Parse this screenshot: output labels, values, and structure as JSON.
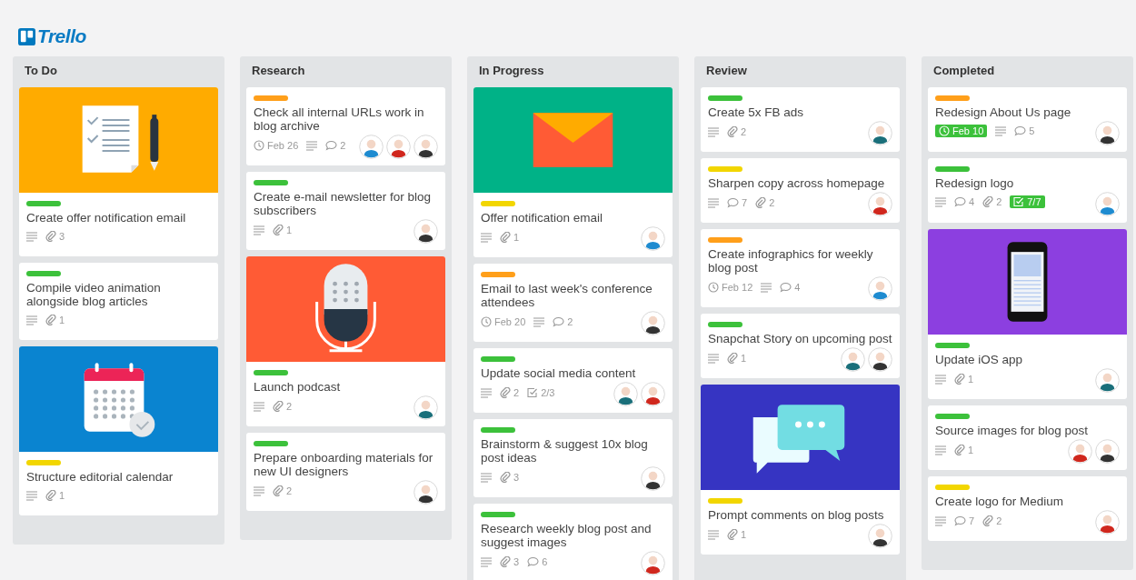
{
  "logo": {
    "text": "Trello"
  },
  "lists": [
    {
      "title": "To Do",
      "cards": [
        {
          "cover": {
            "kind": "document",
            "color": "#ffab00"
          },
          "label": {
            "color": "#3cc13b"
          },
          "title": "Create offer notification email",
          "badges": [
            {
              "kind": "description"
            },
            {
              "kind": "attachments",
              "text": "3"
            }
          ]
        },
        {
          "label": {
            "color": "#3cc13b"
          },
          "title": "Compile video animation alongside blog articles",
          "badges": [
            {
              "kind": "description"
            },
            {
              "kind": "attachments",
              "text": "1"
            }
          ]
        },
        {
          "cover": {
            "kind": "calendar",
            "color": "#0a84d0"
          },
          "label": {
            "color": "#f2d600"
          },
          "title": "Structure editorial calendar",
          "badges": [
            {
              "kind": "description"
            },
            {
              "kind": "attachments",
              "text": "1"
            }
          ]
        }
      ]
    },
    {
      "title": "Research",
      "cards": [
        {
          "label": {
            "color": "#ff9f1a"
          },
          "title": "Check all internal URLs work in blog archive",
          "badges": [
            {
              "kind": "due",
              "text": "Feb 26",
              "complete": false
            },
            {
              "kind": "description"
            },
            {
              "kind": "comments",
              "text": "2"
            }
          ],
          "members": [
            {
              "color": "#1e8bd0"
            },
            {
              "color": "#d0271d"
            },
            {
              "color": "#333333"
            }
          ]
        },
        {
          "label": {
            "color": "#3cc13b"
          },
          "title": "Create e-mail newsletter for blog subscribers",
          "badges": [
            {
              "kind": "description"
            },
            {
              "kind": "attachments",
              "text": "1"
            }
          ],
          "members": [
            {
              "color": "#333333"
            }
          ]
        },
        {
          "cover": {
            "kind": "microphone",
            "color": "#ff5b35"
          },
          "label": {
            "color": "#3cc13b"
          },
          "title": "Launch podcast",
          "badges": [
            {
              "kind": "description"
            },
            {
              "kind": "attachments",
              "text": "2"
            }
          ],
          "members": [
            {
              "color": "#1a6f7a"
            }
          ]
        },
        {
          "label": {
            "color": "#3cc13b"
          },
          "title": "Prepare onboarding materials for new UI designers",
          "badges": [
            {
              "kind": "description"
            },
            {
              "kind": "attachments",
              "text": "2"
            }
          ],
          "members": [
            {
              "color": "#333333"
            }
          ]
        }
      ]
    },
    {
      "title": "In Progress",
      "cards": [
        {
          "cover": {
            "kind": "envelope",
            "color": "#00b287"
          },
          "label": {
            "color": "#f2d600"
          },
          "title": "Offer notification email",
          "badges": [
            {
              "kind": "description"
            },
            {
              "kind": "attachments",
              "text": "1"
            }
          ],
          "members": [
            {
              "color": "#1e8bd0"
            }
          ]
        },
        {
          "label": {
            "color": "#ff9f1a"
          },
          "title": "Email to last week's conference attendees",
          "badges": [
            {
              "kind": "due",
              "text": "Feb 20",
              "complete": false
            },
            {
              "kind": "description"
            },
            {
              "kind": "comments",
              "text": "2"
            }
          ],
          "members": [
            {
              "color": "#333333"
            }
          ]
        },
        {
          "label": {
            "color": "#3cc13b"
          },
          "title": "Update social media content",
          "badges": [
            {
              "kind": "description"
            },
            {
              "kind": "attachments",
              "text": "2"
            },
            {
              "kind": "checklist",
              "text": "2/3",
              "complete": false
            }
          ],
          "members": [
            {
              "color": "#1a6f7a"
            },
            {
              "color": "#d0271d"
            }
          ]
        },
        {
          "label": {
            "color": "#3cc13b"
          },
          "title": "Brainstorm & suggest 10x blog post ideas",
          "badges": [
            {
              "kind": "description"
            },
            {
              "kind": "attachments",
              "text": "3"
            }
          ],
          "members": [
            {
              "color": "#333333"
            }
          ]
        },
        {
          "label": {
            "color": "#3cc13b"
          },
          "title": "Research weekly blog post and suggest images",
          "badges": [
            {
              "kind": "description"
            },
            {
              "kind": "attachments",
              "text": "3"
            },
            {
              "kind": "comments",
              "text": "6"
            }
          ],
          "members": [
            {
              "color": "#d0271d"
            }
          ]
        }
      ]
    },
    {
      "title": "Review",
      "cards": [
        {
          "label": {
            "color": "#3cc13b"
          },
          "title": "Create 5x FB ads",
          "badges": [
            {
              "kind": "description"
            },
            {
              "kind": "attachments",
              "text": "2"
            }
          ],
          "members": [
            {
              "color": "#1a6f7a"
            }
          ]
        },
        {
          "label": {
            "color": "#f2d600"
          },
          "title": "Sharpen copy across homepage",
          "badges": [
            {
              "kind": "description"
            },
            {
              "kind": "comments",
              "text": "7"
            },
            {
              "kind": "attachments",
              "text": "2"
            }
          ],
          "members": [
            {
              "color": "#d0271d"
            }
          ]
        },
        {
          "label": {
            "color": "#ff9f1a"
          },
          "title": "Create infographics for weekly blog post",
          "badges": [
            {
              "kind": "due",
              "text": "Feb 12",
              "complete": false
            },
            {
              "kind": "description"
            },
            {
              "kind": "comments",
              "text": "4"
            }
          ],
          "members": [
            {
              "color": "#1e8bd0"
            }
          ]
        },
        {
          "label": {
            "color": "#3cc13b"
          },
          "title": "Snapchat Story on upcoming post",
          "badges": [
            {
              "kind": "description"
            },
            {
              "kind": "attachments",
              "text": "1"
            }
          ],
          "members": [
            {
              "color": "#1a6f7a"
            },
            {
              "color": "#333333"
            }
          ]
        },
        {
          "cover": {
            "kind": "chat",
            "color": "#3634c2"
          },
          "label": {
            "color": "#f2d600"
          },
          "title": "Prompt comments on blog posts",
          "badges": [
            {
              "kind": "description"
            },
            {
              "kind": "attachments",
              "text": "1"
            }
          ],
          "members": [
            {
              "color": "#333333"
            }
          ]
        }
      ]
    },
    {
      "title": "Completed",
      "cards": [
        {
          "label": {
            "color": "#ff9f1a"
          },
          "title": "Redesign About Us page",
          "badges": [
            {
              "kind": "due",
              "text": "Feb 10",
              "complete": true
            },
            {
              "kind": "description"
            },
            {
              "kind": "comments",
              "text": "5"
            }
          ],
          "members": [
            {
              "color": "#333333"
            }
          ]
        },
        {
          "label": {
            "color": "#3cc13b"
          },
          "title": "Redesign logo",
          "badges": [
            {
              "kind": "description"
            },
            {
              "kind": "comments",
              "text": "4"
            },
            {
              "kind": "attachments",
              "text": "2"
            },
            {
              "kind": "checklist",
              "text": "7/7",
              "complete": true
            }
          ],
          "members": [
            {
              "color": "#1e8bd0"
            }
          ]
        },
        {
          "cover": {
            "kind": "phone",
            "color": "#8c3fe0"
          },
          "label": {
            "color": "#3cc13b"
          },
          "title": "Update iOS app",
          "badges": [
            {
              "kind": "description"
            },
            {
              "kind": "attachments",
              "text": "1"
            }
          ],
          "members": [
            {
              "color": "#1a6f7a"
            }
          ]
        },
        {
          "label": {
            "color": "#3cc13b"
          },
          "title": "Source images for blog post",
          "badges": [
            {
              "kind": "description"
            },
            {
              "kind": "attachments",
              "text": "1"
            }
          ],
          "members": [
            {
              "color": "#d0271d"
            },
            {
              "color": "#333333"
            }
          ]
        },
        {
          "label": {
            "color": "#f2d600"
          },
          "title": "Create logo for Medium",
          "badges": [
            {
              "kind": "description"
            },
            {
              "kind": "comments",
              "text": "7"
            },
            {
              "kind": "attachments",
              "text": "2"
            }
          ],
          "members": [
            {
              "color": "#d0271d"
            }
          ]
        }
      ]
    }
  ]
}
